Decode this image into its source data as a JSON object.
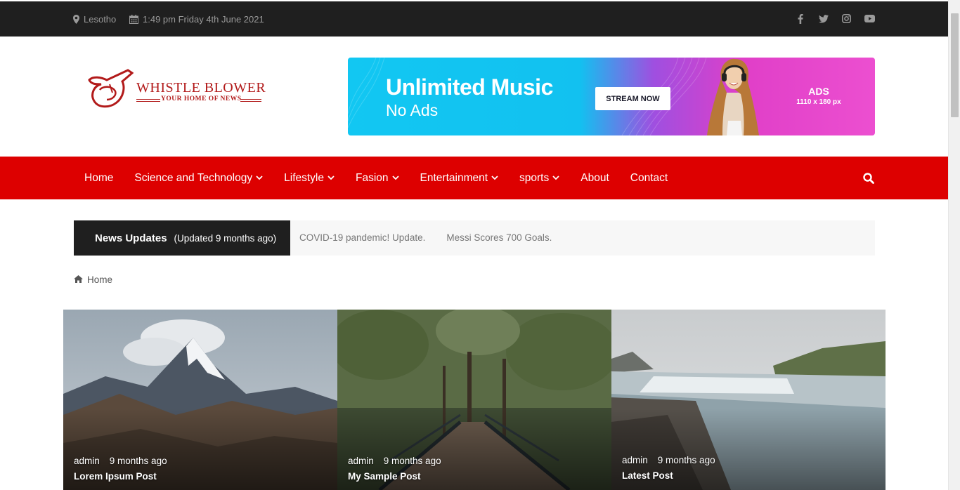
{
  "topbar": {
    "location": "Lesotho",
    "datetime": "1:49 pm Friday 4th June 2021",
    "social": [
      "facebook-icon",
      "twitter-icon",
      "instagram-icon",
      "youtube-icon"
    ]
  },
  "header": {
    "logo_title": "WHISTLE BLOWER",
    "logo_tagline": "YOUR HOME OF NEWS",
    "ad": {
      "headline": "Unlimited Music",
      "subline": "No Ads",
      "button": "STREAM NOW",
      "ads_label": "ADS",
      "ads_size": "1110 x 180 px"
    }
  },
  "nav": {
    "items": [
      {
        "label": "Home",
        "dropdown": false
      },
      {
        "label": "Science and Technology",
        "dropdown": true
      },
      {
        "label": "Lifestyle",
        "dropdown": true
      },
      {
        "label": "Fasion",
        "dropdown": true
      },
      {
        "label": "Entertainment",
        "dropdown": true
      },
      {
        "label": "sports",
        "dropdown": true
      },
      {
        "label": "About",
        "dropdown": false
      },
      {
        "label": "Contact",
        "dropdown": false
      }
    ],
    "search_icon": "search-icon"
  },
  "ticker": {
    "title": "News Updates",
    "updated": "(Updated 9 months ago)",
    "items": [
      "COVID-19 pandemic! Update.",
      "Messi Scores 700 Goals."
    ]
  },
  "breadcrumb": {
    "home": "Home"
  },
  "posts": [
    {
      "author": "admin",
      "time": "9 months ago",
      "title": "Lorem Ipsum Post"
    },
    {
      "author": "admin",
      "time": "9 months ago",
      "title": "My Sample Post"
    },
    {
      "author": "admin",
      "time": "9 months ago",
      "title": "Latest Post"
    }
  ],
  "colors": {
    "topbar": "#1f1f1f",
    "nav": "#dd0000",
    "logo": "#b21a1a"
  }
}
